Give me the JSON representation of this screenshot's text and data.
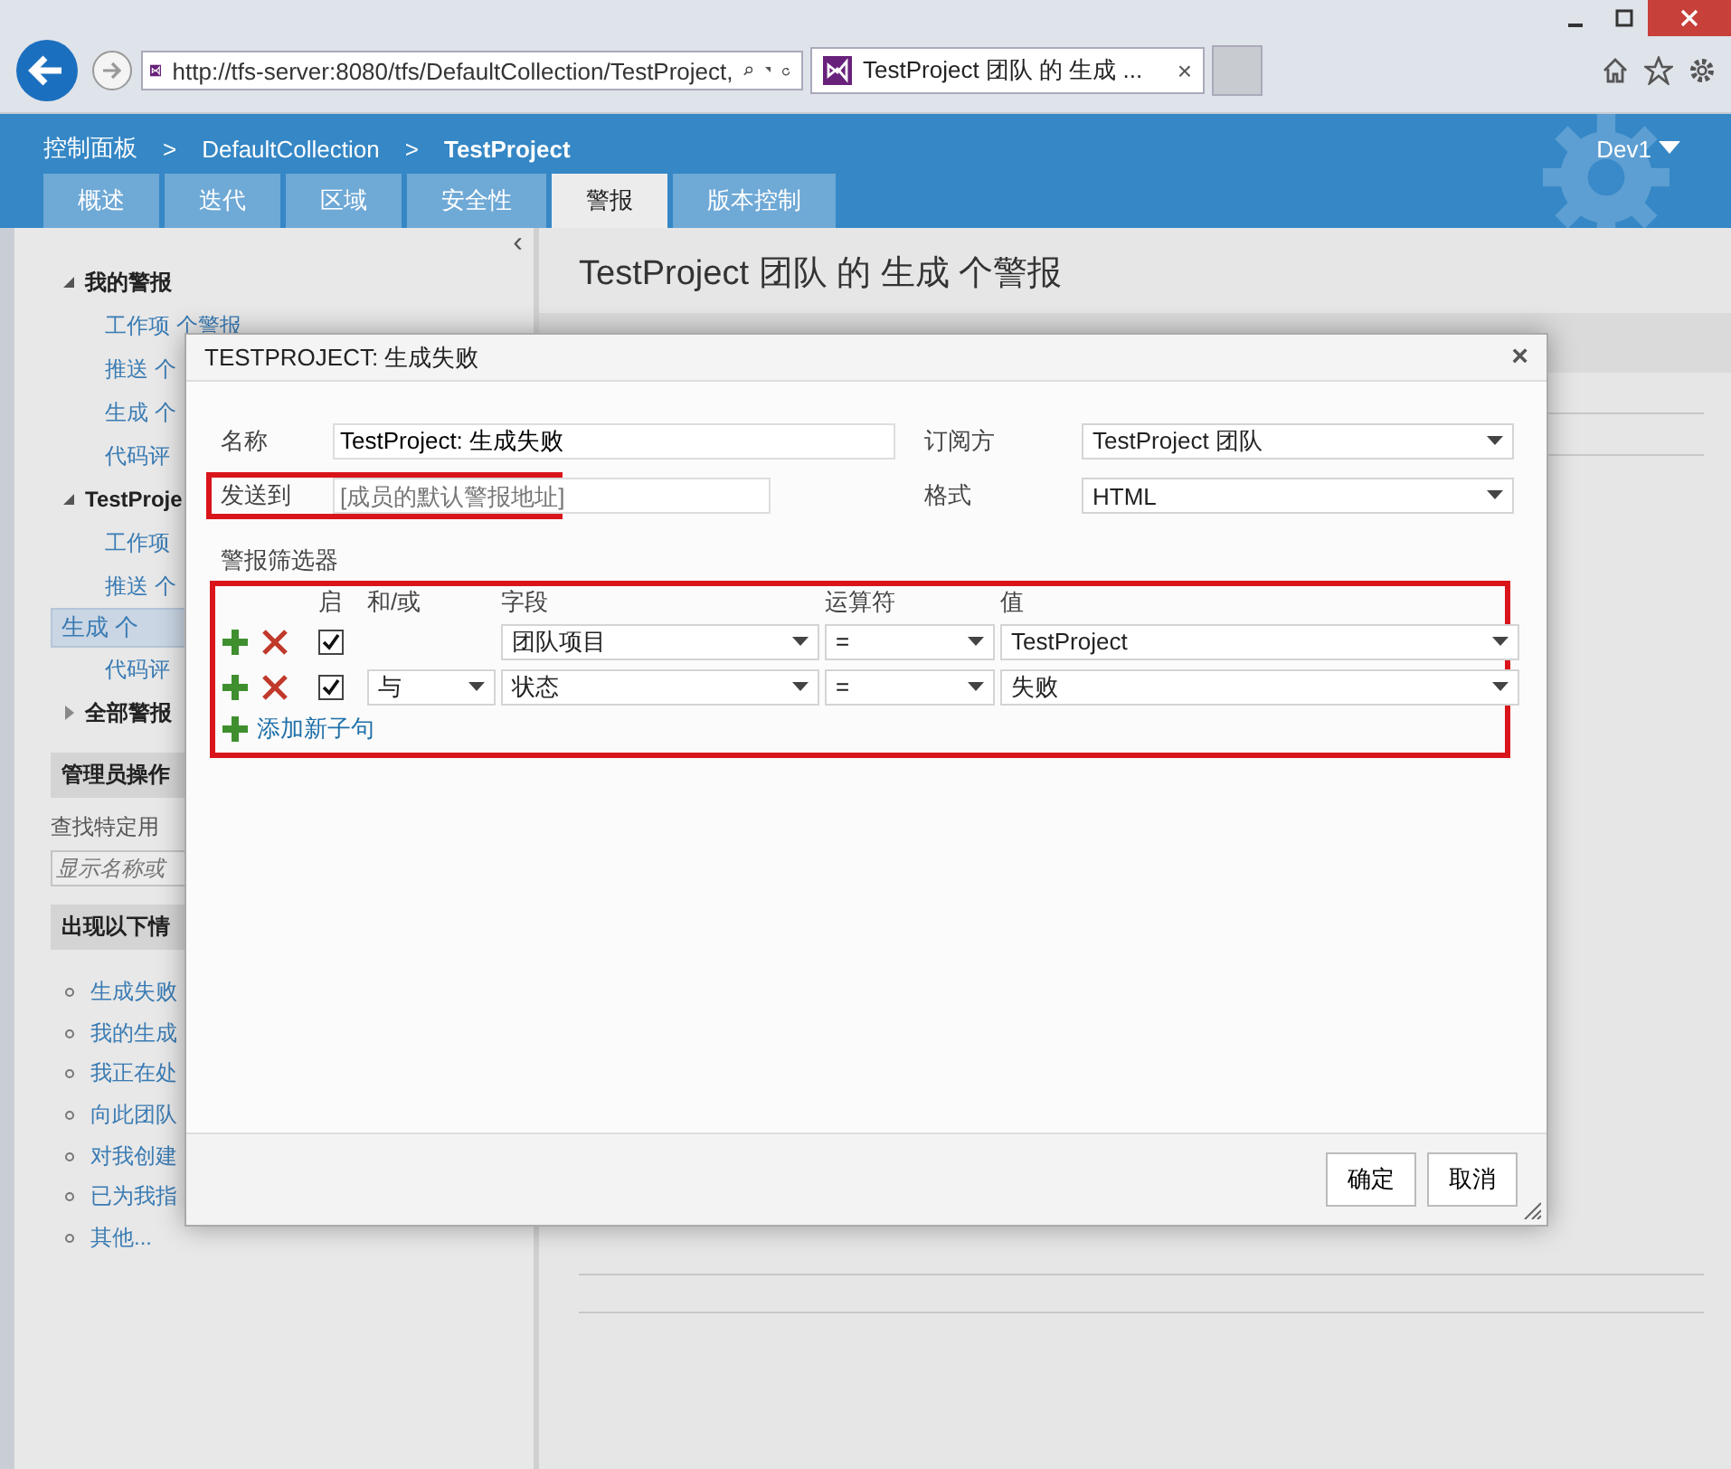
{
  "browser": {
    "url": "http://tfs-server:8080/tfs/DefaultCollection/TestProject,",
    "tab_title": "TestProject 团队 的 生成 ...",
    "tab_close": "×"
  },
  "header": {
    "breadcrumb": [
      "控制面板",
      "DefaultCollection",
      "TestProject"
    ],
    "separator": ">",
    "user": "Dev1"
  },
  "tabs": [
    {
      "label": "概述",
      "selected": false
    },
    {
      "label": "迭代",
      "selected": false
    },
    {
      "label": "区域",
      "selected": false
    },
    {
      "label": "安全性",
      "selected": false
    },
    {
      "label": "警报",
      "selected": true
    },
    {
      "label": "版本控制",
      "selected": false
    }
  ],
  "sidebar": {
    "collapse": "‹",
    "groups": [
      {
        "label": "我的警报",
        "expanded": true,
        "children": [
          {
            "label": "工作项 个警报",
            "selected": false
          },
          {
            "label": "推送 个",
            "selected": false
          },
          {
            "label": "生成 个",
            "selected": false
          },
          {
            "label": "代码评",
            "selected": false
          }
        ]
      },
      {
        "label": "TestProje",
        "expanded": true,
        "children": [
          {
            "label": "工作项",
            "selected": false
          },
          {
            "label": "推送 个",
            "selected": false
          },
          {
            "label": "生成 个",
            "selected": true
          },
          {
            "label": "代码评",
            "selected": false
          }
        ]
      },
      {
        "label": "全部警报",
        "expanded": false
      }
    ],
    "admin_header": "管理员操作",
    "find_label": "查找特定用",
    "find_placeholder": "显示名称或",
    "when_header": "出现以下情",
    "when_links": [
      "生成失败",
      "我的生成",
      "我正在处",
      "向此团队",
      "对我创建",
      "已为我指",
      "其他..."
    ]
  },
  "main": {
    "title": "TestProject 团队 的 生成 个警报"
  },
  "dialog": {
    "title": "TESTPROJECT: 生成失败",
    "close": "×",
    "name_label": "名称",
    "name_value": "TestProject: 生成失败",
    "subscriber_label": "订阅方",
    "subscriber_value": "TestProject 团队",
    "send_label": "发送到",
    "send_placeholder": "[成员的默认警报地址]",
    "send_highlighted": true,
    "format_label": "格式",
    "format_value": "HTML",
    "filter_label": "警报筛选器",
    "filter_highlighted": true,
    "columns": [
      "启",
      "和/或",
      "字段",
      "运算符",
      "值"
    ],
    "clauses": [
      {
        "enabled": true,
        "field": "团队项目",
        "operator": "=",
        "value": "TestProject"
      },
      {
        "enabled": true,
        "andor": "与",
        "field": "状态",
        "operator": "=",
        "value": "失败"
      }
    ],
    "add_clause": "添加新子句",
    "buttons": [
      "确定",
      "取消"
    ]
  }
}
